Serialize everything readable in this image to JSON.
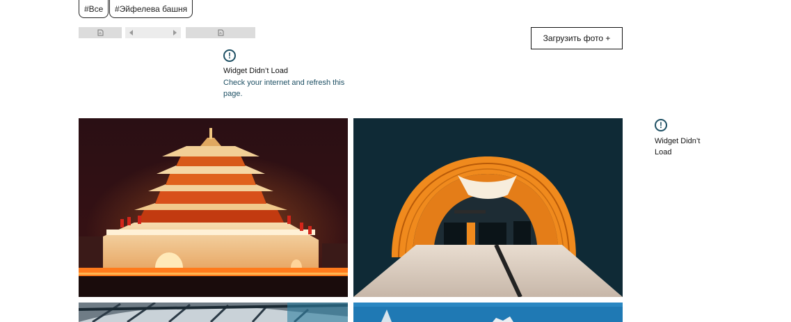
{
  "tags": {
    "all": "#Все",
    "eiffel": "#Эйфелева башня"
  },
  "toolbar": {
    "upload_label": "Загрузить фото +"
  },
  "widget_main": {
    "title": "Widget Didn’t Load",
    "hint": "Check your internet and refresh this page."
  },
  "widget_side": {
    "title": "Widget Didn’t Load"
  },
  "icons": {
    "error": "exclamation-circle-icon",
    "broken_image": "broken-image-icon",
    "arrow_left": "arrow-left-icon",
    "arrow_right": "arrow-right-icon"
  },
  "colors": {
    "accent": "#1d4f63",
    "border": "#111111",
    "placeholder": "#dcdcdc"
  },
  "gallery": {
    "photos": [
      {
        "subject": "illuminated-pagoda-tower"
      },
      {
        "subject": "orange-metro-tunnel"
      },
      {
        "subject": "steel-glass-structure"
      },
      {
        "subject": "blue-sky-building"
      }
    ]
  }
}
